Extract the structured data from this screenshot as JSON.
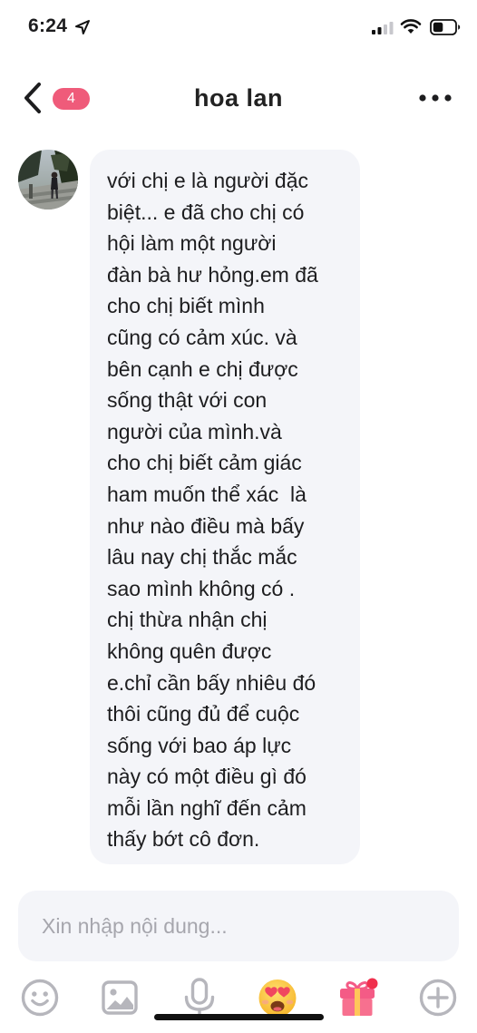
{
  "status_bar": {
    "time": "6:24"
  },
  "header": {
    "unread_count": "4",
    "title": "hoa lan"
  },
  "message": {
    "text": "với chị e là người đặc\nbiệt... e đã cho chị có\nhội làm một người\nđàn bà hư hỏng.em đã\ncho chị biết mình\ncũng có cảm xúc. và\nbên cạnh e chị được\nsống thật với con\nngười của mình.và\ncho chị biết cảm giác\nham muốn thể xác  là\nnhư nào điều mà bấy\nlâu nay chị thắc mắc\nsao mình không có .\nchị thừa nhận chị\nkhông quên được\ne.chỉ cần bấy nhiêu đó\nthôi cũng đủ để cuộc\nsống với bao áp lực\nnày có một điều gì đó\nmỗi lần nghĩ đến cảm\nthấy bớt cô đơn."
  },
  "composer": {
    "placeholder": "Xin nhập nội dung..."
  },
  "toolbar": {
    "icons": [
      "emoji-icon",
      "image-icon",
      "microphone-icon",
      "heart-eyes-sticker-icon",
      "gift-icon",
      "plus-icon"
    ]
  },
  "colors": {
    "badge": "#ef5b7a",
    "bubble": "#f4f5f9",
    "icon_gray": "#b6b6bc",
    "gift_pink": "#f45b86"
  }
}
